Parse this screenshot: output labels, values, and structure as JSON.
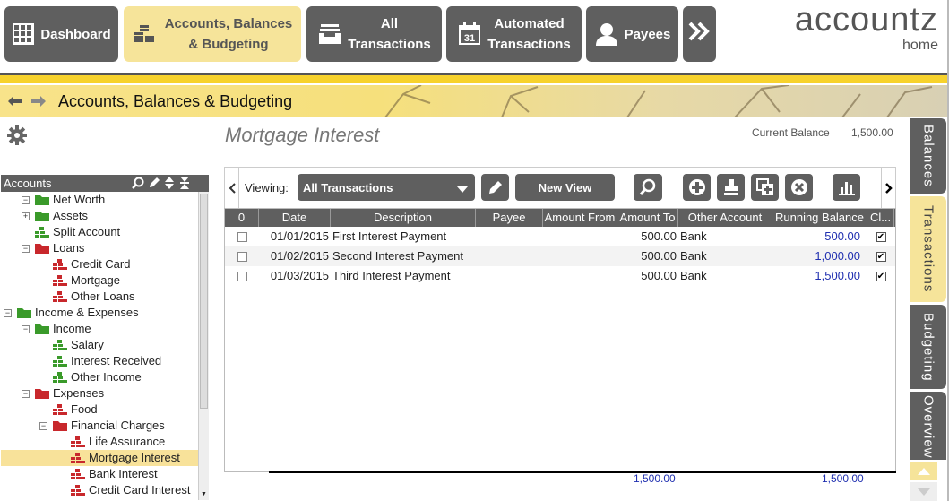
{
  "nav": {
    "dashboard": "Dashboard",
    "accounts_line1": "Accounts, Balances",
    "accounts_line2": "& Budgeting",
    "all_line1": "All",
    "all_line2": "Transactions",
    "auto_line1": "Automated",
    "auto_line2": "Transactions",
    "payees": "Payees",
    "calendar_day": "31",
    "brand_big": "accountz",
    "brand_small": "home"
  },
  "header": {
    "title": "Accounts, Balances & Budgeting"
  },
  "tree": {
    "title": "Accounts",
    "items": [
      {
        "label": "Net Worth",
        "level": 0,
        "toggle": "−",
        "icon": "folder-green"
      },
      {
        "label": "Assets",
        "level": 1,
        "toggle": "+",
        "icon": "folder-green"
      },
      {
        "label": "Split Account",
        "level": 1,
        "toggle": "",
        "icon": "account-green"
      },
      {
        "label": "Loans",
        "level": 0,
        "toggle": "−",
        "icon": "folder-red"
      },
      {
        "label": "Credit Card",
        "level": 2,
        "toggle": "",
        "icon": "account-red"
      },
      {
        "label": "Mortgage",
        "level": 2,
        "toggle": "",
        "icon": "account-red"
      },
      {
        "label": "Other Loans",
        "level": 2,
        "toggle": "",
        "icon": "account-red"
      },
      {
        "label": "Income & Expenses",
        "level": -1,
        "toggle": "−",
        "icon": "folder-green"
      },
      {
        "label": "Income",
        "level": 0,
        "toggle": "−",
        "icon": "folder-green"
      },
      {
        "label": "Salary",
        "level": 2,
        "toggle": "",
        "icon": "account-green"
      },
      {
        "label": "Interest Received",
        "level": 2,
        "toggle": "",
        "icon": "account-green"
      },
      {
        "label": "Other Income",
        "level": 2,
        "toggle": "",
        "icon": "account-green"
      },
      {
        "label": "Expenses",
        "level": 0,
        "toggle": "−",
        "icon": "folder-red"
      },
      {
        "label": "Food",
        "level": 2,
        "toggle": "",
        "icon": "account-red"
      },
      {
        "label": "Financial Charges",
        "level": 1,
        "toggle": "−",
        "icon": "folder-red"
      },
      {
        "label": "Life Assurance",
        "level": 3,
        "toggle": "",
        "icon": "account-red"
      },
      {
        "label": "Mortgage Interest",
        "level": 3,
        "toggle": "",
        "icon": "account-red",
        "selected": true
      },
      {
        "label": "Bank Interest",
        "level": 3,
        "toggle": "",
        "icon": "account-red"
      },
      {
        "label": "Credit Card Interest",
        "level": 3,
        "toggle": "",
        "icon": "account-red"
      }
    ]
  },
  "account": {
    "title": "Mortgage Interest",
    "current_balance_label": "Current Balance",
    "current_balance": "1,500.00"
  },
  "toolbar": {
    "viewing_label": "Viewing:",
    "view_value": "All Transactions",
    "new_view": "New View"
  },
  "grid": {
    "columns": [
      "0",
      "Date",
      "Description",
      "Payee",
      "Amount From",
      "Amount To",
      "Other Account",
      "Running Balance",
      "Cl..."
    ],
    "rows": [
      {
        "date": "01/01/2015",
        "description": "First Interest Payment",
        "payee": "",
        "amount_from": "",
        "amount_to": "500.00",
        "other_account": "Bank",
        "running_balance": "500.00",
        "cleared": "✔"
      },
      {
        "date": "01/02/2015",
        "description": "Second Interest Payment",
        "payee": "",
        "amount_from": "",
        "amount_to": "500.00",
        "other_account": "Bank",
        "running_balance": "1,000.00",
        "cleared": "✔"
      },
      {
        "date": "01/03/2015",
        "description": "Third Interest Payment",
        "payee": "",
        "amount_from": "",
        "amount_to": "500.00",
        "other_account": "Bank",
        "running_balance": "1,500.00",
        "cleared": "✔"
      }
    ],
    "total_amount_to": "1,500.00",
    "total_running_balance": "1,500.00"
  },
  "side_tabs": [
    "Balances",
    "Transactions",
    "Budgeting",
    "Overview"
  ],
  "colors": {
    "accent_yellow": "#f6e49a",
    "nav_dark": "#5f5f5f",
    "folder_green": "#3a9a2a",
    "folder_red": "#c8282c",
    "link_blue": "#2030b0"
  }
}
